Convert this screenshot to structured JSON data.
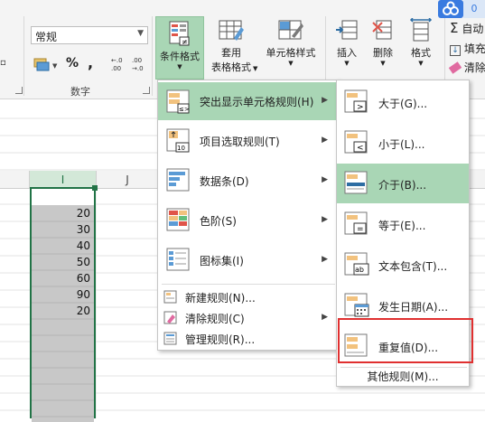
{
  "ribbon": {
    "number_group": {
      "format_value": "常规",
      "percent_symbol": "%",
      "comma_symbol": ",",
      "group_label": "数字"
    },
    "styles_group": {
      "conditional_format_label": "条件格式",
      "table_format_label_line1": "套用",
      "table_format_label_line2": "表格格式",
      "cell_style_label": "单元格样式"
    },
    "cells_group": {
      "insert_label": "插入",
      "delete_label": "删除",
      "format_label": "格式"
    },
    "editing_group": {
      "autosum_label": "自动",
      "fill_label": "填充",
      "clear_label": "清除"
    },
    "cloud_badge": "0"
  },
  "sheet": {
    "columns": [
      "I",
      "J"
    ],
    "values": [
      "20",
      "30",
      "40",
      "50",
      "60",
      "90",
      "20"
    ]
  },
  "cf_menu": {
    "items": [
      {
        "label": "突出显示单元格规则(H)"
      },
      {
        "label": "项目选取规则(T)"
      },
      {
        "label": "数据条(D)"
      },
      {
        "label": "色阶(S)"
      },
      {
        "label": "图标集(I)"
      }
    ],
    "small_items": [
      {
        "label": "新建规则(N)..."
      },
      {
        "label": "清除规则(C)"
      },
      {
        "label": "管理规则(R)..."
      }
    ]
  },
  "hl_submenu": {
    "items": [
      {
        "label": "大于(G)..."
      },
      {
        "label": "小于(L)..."
      },
      {
        "label": "介于(B)..."
      },
      {
        "label": "等于(E)..."
      },
      {
        "label": "文本包含(T)..."
      },
      {
        "label": "发生日期(A)..."
      },
      {
        "label": "重复值(D)..."
      }
    ],
    "more_rules": "其他规则(M)...",
    "symbols": {
      "greater": ">",
      "less": "<",
      "equal": "=",
      "text": "ab"
    }
  },
  "colors": {
    "menu_highlight": "#a9d6b5",
    "selection_border": "#217346",
    "selected_fill": "#c8c8c8",
    "annotation_box": "#e03030",
    "cloud_blue": "#3a7be0"
  }
}
